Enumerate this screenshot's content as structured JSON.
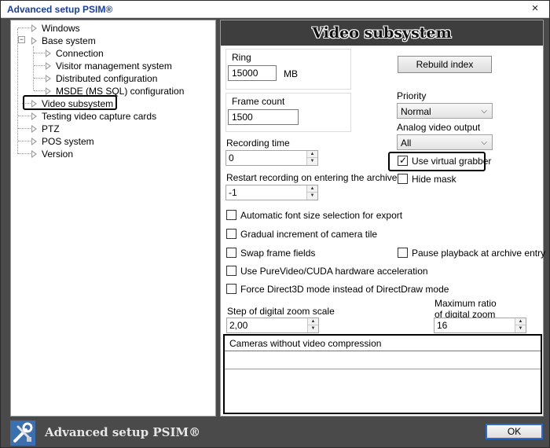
{
  "window": {
    "title": "Advanced setup PSIM®",
    "close_glyph": "×"
  },
  "tree": {
    "items": [
      {
        "label": "Windows"
      },
      {
        "label": "Base system"
      },
      {
        "label": "Connection"
      },
      {
        "label": "Visitor management system"
      },
      {
        "label": "Distributed configuration"
      },
      {
        "label": "MSDE (MS SQL) configuration"
      },
      {
        "label": "Video subsystem"
      },
      {
        "label": "Testing video capture cards"
      },
      {
        "label": "PTZ"
      },
      {
        "label": "POS system"
      },
      {
        "label": "Version"
      }
    ],
    "selected": "Video subsystem"
  },
  "panel": {
    "title": "Video subsystem",
    "ring": {
      "label": "Ring",
      "value": "15000",
      "unit": "MB"
    },
    "frame_count": {
      "label": "Frame count",
      "value": "1500"
    },
    "recording_time": {
      "label": "Recording time",
      "value": "0"
    },
    "restart_recording": {
      "label": "Restart recording on entering the archive",
      "value": "-1"
    },
    "rebuild_index_label": "Rebuild index",
    "priority": {
      "label": "Priority",
      "value": "Normal"
    },
    "analog_output": {
      "label": "Analog video output",
      "value": "All"
    },
    "use_virtual_grabber": {
      "label": "Use virtual grabber",
      "checked": true
    },
    "hide_mask": {
      "label": "Hide mask",
      "checked": false
    },
    "checkboxes": [
      {
        "label": "Automatic font size selection for export",
        "checked": false
      },
      {
        "label": "Gradual increment of camera tile",
        "checked": false
      },
      {
        "label": "Swap frame fields",
        "checked": false
      },
      {
        "label": "Use PureVideo/CUDA hardware acceleration",
        "checked": false
      },
      {
        "label": "Force Direct3D mode instead of DirectDraw mode",
        "checked": false
      }
    ],
    "pause_playback": {
      "label": "Pause playback at archive entry",
      "checked": false
    },
    "zoom_step": {
      "label": "Step of digital zoom scale",
      "value": "2,00"
    },
    "max_ratio": {
      "label_line1": "Maximum ratio",
      "label_line2": "of digital zoom",
      "value": "16"
    },
    "cameras_table": {
      "header": "Cameras without video compression"
    }
  },
  "footer": {
    "brand": "Advanced setup PSIM®",
    "ok_label": "OK"
  }
}
